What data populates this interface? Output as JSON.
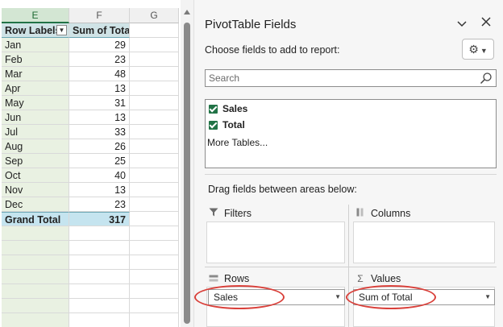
{
  "sheet": {
    "columns": [
      "E",
      "F",
      "G"
    ],
    "header": {
      "row_labels": "Row Labels",
      "sum_of_total": "Sum of Total"
    },
    "rows": [
      {
        "label": "Jan",
        "value": "29"
      },
      {
        "label": "Feb",
        "value": "23"
      },
      {
        "label": "Mar",
        "value": "48"
      },
      {
        "label": "Apr",
        "value": "13"
      },
      {
        "label": "May",
        "value": "31"
      },
      {
        "label": "Jun",
        "value": "13"
      },
      {
        "label": "Jul",
        "value": "33"
      },
      {
        "label": "Aug",
        "value": "26"
      },
      {
        "label": "Sep",
        "value": "25"
      },
      {
        "label": "Oct",
        "value": "40"
      },
      {
        "label": "Nov",
        "value": "13"
      },
      {
        "label": "Dec",
        "value": "23"
      }
    ],
    "grand_total": {
      "label": "Grand Total",
      "value": "317"
    }
  },
  "pane": {
    "title": "PivotTable Fields",
    "choose_label": "Choose fields to add to report:",
    "search_placeholder": "Search",
    "fields": [
      {
        "label": "Sales",
        "checked": true
      },
      {
        "label": "Total",
        "checked": true
      }
    ],
    "more_tables": "More Tables...",
    "drag_label": "Drag fields between areas below:",
    "areas": {
      "filters": "Filters",
      "columns": "Columns",
      "rows": "Rows",
      "values": "Values"
    },
    "rows_field": "Sales",
    "values_field": "Sum of Total"
  },
  "colors": {
    "accent": "#217346",
    "highlight_circle": "#d9403a",
    "pivot_header": "#cfe3e6"
  }
}
